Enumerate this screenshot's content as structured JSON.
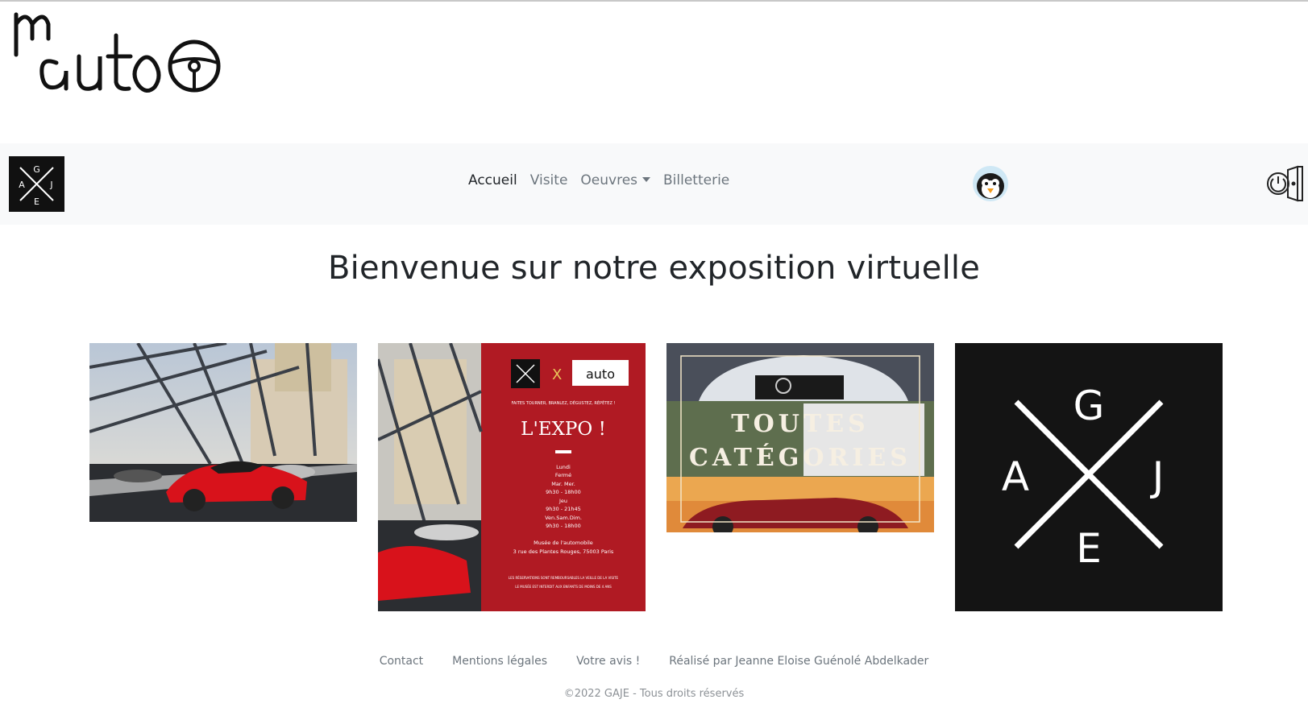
{
  "logo": {
    "text": "auto",
    "alt_mark": "m"
  },
  "navbar": {
    "brand_letters": {
      "top": "G",
      "left": "A",
      "right": "J",
      "bottom": "E"
    },
    "links": [
      {
        "label": "Accueil",
        "active": true
      },
      {
        "label": "Visite",
        "active": false
      },
      {
        "label": "Oeuvres",
        "active": false,
        "dropdown": true
      },
      {
        "label": "Billetterie",
        "active": false
      }
    ]
  },
  "main": {
    "title": "Bienvenue sur notre exposition virtuelle",
    "cards": {
      "expo_poster": {
        "tagline": "FAITES TOURNER, BRANLEZ, DÉGUSTEZ, RÉPÉTEZ !",
        "headline": "L'EXPO !",
        "schedule": [
          "Lundi",
          "Fermé",
          "Mar. Mer.",
          "9h30 - 18h00",
          "Jeu",
          "9h30 - 21h45",
          "Ven.Sam.Dim.",
          "9h30 - 18h00"
        ],
        "venue": "Musée de l'automobile",
        "address": "3 rue des Plantes Rouges, 75003 Paris",
        "notice_1": "LES RÉSERVATIONS SONT REMBOURSABLES LA VEILLE DE LA VISITE",
        "notice_2": "LE MUSÉE EST INTERDIT AUX ENFANTS DE MOINS DE 4 ANS"
      },
      "categories": {
        "line_1": "TOUTES",
        "line_2": "CATÉGORIES"
      },
      "gaje_logo": {
        "top": "G",
        "left": "A",
        "right": "J",
        "bottom": "E"
      }
    }
  },
  "footer": {
    "links": [
      "Contact",
      "Mentions légales",
      "Votre avis !",
      "Réalisé par Jeanne Eloise Guénolé Abdelkader"
    ],
    "copyright": "©2022 GAJE - Tous droits réservés"
  },
  "colors": {
    "poster_red": "#b01a23",
    "navbar_bg": "#f8f9fa",
    "car_red": "#d8121b"
  }
}
